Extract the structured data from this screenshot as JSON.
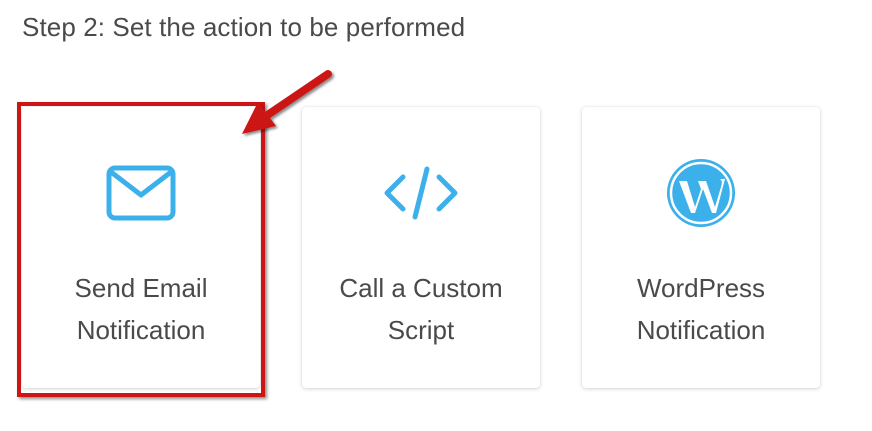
{
  "step": {
    "title": "Step 2: Set the action to be performed"
  },
  "actions": [
    {
      "label_line1": "Send Email",
      "label_line2": "Notification",
      "icon": "envelope-icon",
      "highlighted": true
    },
    {
      "label_line1": "Call a Custom",
      "label_line2": "Script",
      "icon": "code-icon",
      "highlighted": false
    },
    {
      "label_line1": "WordPress",
      "label_line2": "Notification",
      "icon": "wordpress-icon",
      "highlighted": false
    }
  ],
  "colors": {
    "icon_accent": "#3bb0ea",
    "highlight": "#cc1616",
    "text": "#4a4a4a"
  }
}
